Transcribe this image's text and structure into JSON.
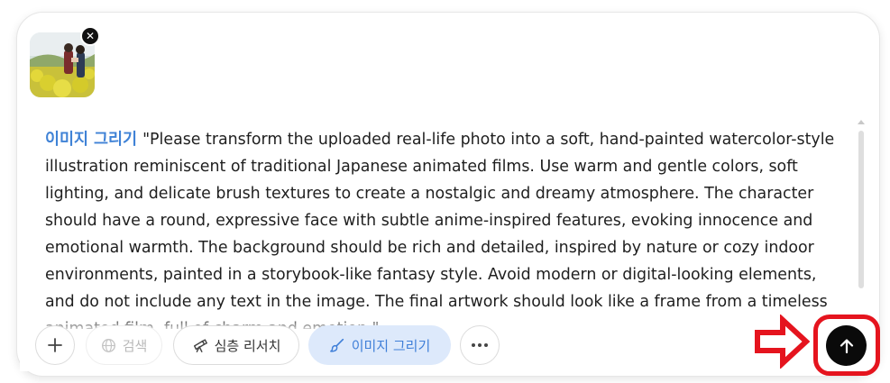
{
  "attachment": {
    "remove_symbol": "✕",
    "icon": "close-icon"
  },
  "prompt": {
    "tag": "이미지 그리기",
    "text": "\"Please transform the uploaded real-life photo into a soft, hand-painted watercolor-style illustration reminiscent of traditional Japanese animated films. Use warm and gentle colors, soft lighting, and delicate brush textures to create a nostalgic and dreamy atmosphere. The character should have a round, expressive face with subtle anime-inspired features, evoking innocence and emotional warmth. The background should be rich and detailed, inspired by nature or cozy indoor environments, painted in a storybook-like fantasy style. Avoid modern or digital-looking elements, and do not include any text in the image. The final artwork should look like a frame from a timeless animated film, full of charm and emotion.\""
  },
  "toolbar": {
    "add_icon": "plus-icon",
    "search_label": "검색",
    "search_icon": "globe-icon",
    "research_label": "심층 리서치",
    "research_icon": "telescope-icon",
    "image_label": "이미지 그리기",
    "image_icon": "brush-icon",
    "more_icon": "more-dots-icon",
    "send_icon": "arrow-up-icon"
  },
  "colors": {
    "accent": "#3f82d6",
    "active_pill_bg": "#dde9fb",
    "send_bg": "#0a0a0a",
    "annotation_red": "#e5141e"
  }
}
